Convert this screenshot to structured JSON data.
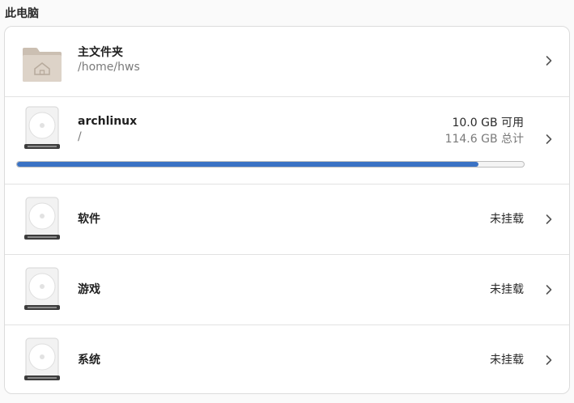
{
  "section": {
    "title": "此电脑"
  },
  "items": [
    {
      "name": "主文件夹",
      "path": "/home/hws",
      "icon": "home-folder-icon"
    },
    {
      "name": "archlinux",
      "path": "/",
      "free": "10.0 GB 可用",
      "total": "114.6 GB 总计",
      "used_fraction": 0.91,
      "icon": "drive-icon"
    },
    {
      "name": "软件",
      "status": "未挂载",
      "icon": "drive-icon"
    },
    {
      "name": "游戏",
      "status": "未挂载",
      "icon": "drive-icon"
    },
    {
      "name": "系统",
      "status": "未挂载",
      "icon": "drive-icon"
    }
  ],
  "colors": {
    "accent": "#3a72c4",
    "folder": "#dcd3c9"
  }
}
